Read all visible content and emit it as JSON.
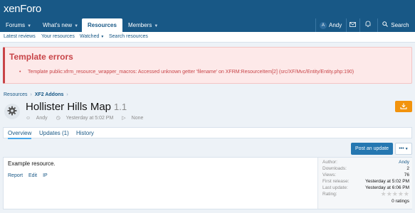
{
  "header": {
    "logo_prefix": "xen",
    "logo_suffix": "Foro"
  },
  "nav": {
    "forums": "Forums",
    "whats_new": "What's new",
    "resources": "Resources",
    "members": "Members",
    "user": "Andy",
    "user_initial": "A",
    "search": "Search"
  },
  "subnav": {
    "latest_reviews": "Latest reviews",
    "your_resources": "Your resources",
    "watched": "Watched",
    "search_resources": "Search resources"
  },
  "errors": {
    "title": "Template errors",
    "message": "Template public:xfrm_resource_wrapper_macros: Accessed unknown getter 'filename' on XFRM:ResourceItem[2] (src/XF/Mvc/Entity/Entity.php:190)"
  },
  "breadcrumb": {
    "item1": "Resources",
    "item2": "XF2 Addons"
  },
  "resource": {
    "title": "Hollister Hills Map",
    "version": "1.1",
    "author": "Andy",
    "date": "Yesterday at 5:02 PM",
    "tags": "None",
    "description": "Example resource."
  },
  "tabs": {
    "overview": "Overview",
    "updates": "Updates (1)",
    "history": "History"
  },
  "buttons": {
    "post_update": "Post an update",
    "more": "•••"
  },
  "actions": {
    "report": "Report",
    "edit": "Edit",
    "ip": "IP"
  },
  "info": {
    "author_label": "Author:",
    "author_value": "Andy",
    "downloads_label": "Downloads:",
    "downloads_value": "2",
    "views_label": "Views:",
    "views_value": "76",
    "first_release_label": "First release:",
    "first_release_value": "Yesterday at 5:02 PM",
    "last_update_label": "Last update:",
    "last_update_value": "Yesterday at 6:06 PM",
    "rating_label": "Rating:",
    "rating_stars": 0,
    "ratings_count": "0 ratings"
  },
  "colors": {
    "header": "#185886",
    "error": "#c84448",
    "download": "#f2930d",
    "primary_button": "#2577b1"
  }
}
